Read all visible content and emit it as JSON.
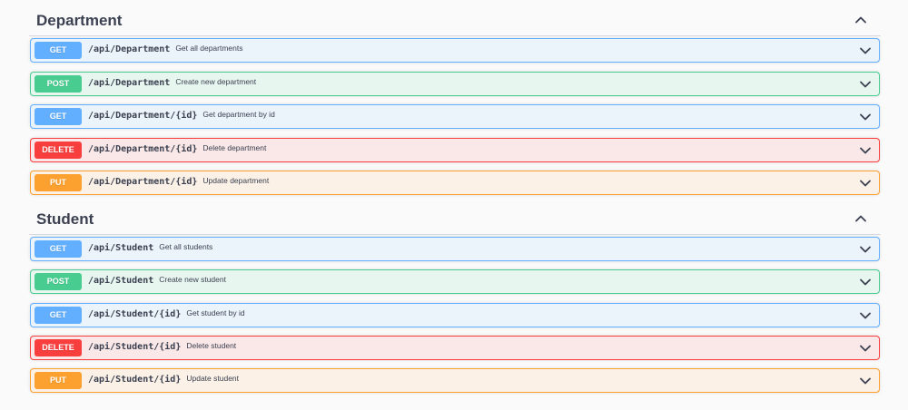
{
  "sections": [
    {
      "title": "Department",
      "operations": [
        {
          "method": "GET",
          "path": "/api/Department",
          "summary": "Get all departments"
        },
        {
          "method": "POST",
          "path": "/api/Department",
          "summary": "Create new department"
        },
        {
          "method": "GET",
          "path": "/api/Department/{id}",
          "summary": "Get department by id"
        },
        {
          "method": "DELETE",
          "path": "/api/Department/{id}",
          "summary": "Delete department"
        },
        {
          "method": "PUT",
          "path": "/api/Department/{id}",
          "summary": "Update department"
        }
      ]
    },
    {
      "title": "Student",
      "operations": [
        {
          "method": "GET",
          "path": "/api/Student",
          "summary": "Get all students"
        },
        {
          "method": "POST",
          "path": "/api/Student",
          "summary": "Create new student"
        },
        {
          "method": "GET",
          "path": "/api/Student/{id}",
          "summary": "Get student by id"
        },
        {
          "method": "DELETE",
          "path": "/api/Student/{id}",
          "summary": "Delete student"
        },
        {
          "method": "PUT",
          "path": "/api/Student/{id}",
          "summary": "Update student"
        }
      ]
    }
  ],
  "colors": {
    "get": "#61affe",
    "post": "#49cc90",
    "delete": "#f93e3e",
    "put": "#fca130"
  },
  "icons": {
    "section_toggle": "chevron-up-icon",
    "operation_toggle": "chevron-down-icon"
  }
}
